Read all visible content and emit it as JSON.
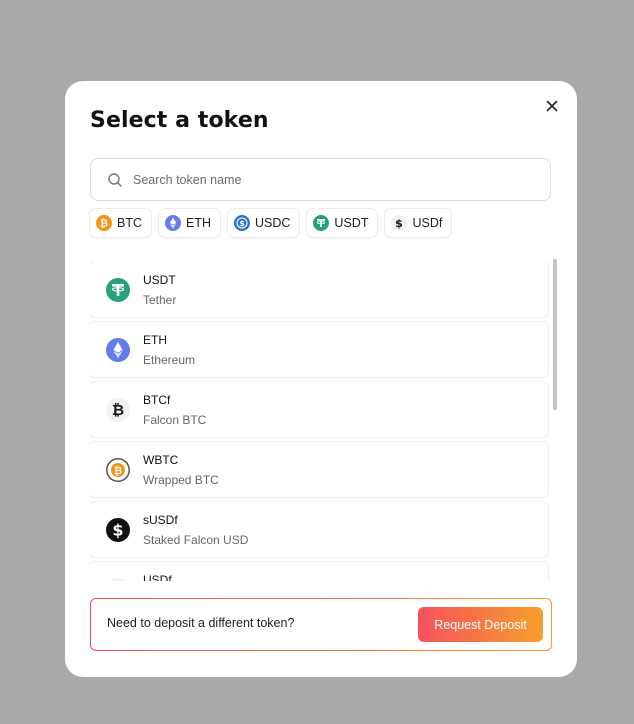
{
  "modal": {
    "title": "Select a token",
    "close_label": "×"
  },
  "search": {
    "placeholder": "Search token name",
    "value": ""
  },
  "quick_tokens": [
    {
      "symbol": "BTC",
      "icon": "btc-icon",
      "color": "#f7931a"
    },
    {
      "symbol": "ETH",
      "icon": "eth-icon",
      "color": "#627eea"
    },
    {
      "symbol": "USDC",
      "icon": "usdc-icon",
      "color": "#2775ca"
    },
    {
      "symbol": "USDT",
      "icon": "usdt-icon",
      "color": "#26a17b"
    },
    {
      "symbol": "USDf",
      "icon": "usdf-icon",
      "color": "#1a1a1a"
    }
  ],
  "tokens": [
    {
      "symbol": "USDT",
      "name": "Tether",
      "icon": "usdt-icon",
      "color": "#26a17b"
    },
    {
      "symbol": "ETH",
      "name": "Ethereum",
      "icon": "eth-icon",
      "color": "#627eea"
    },
    {
      "symbol": "BTCf",
      "name": "Falcon BTC",
      "icon": "btcf-icon",
      "color": "#1a1a1a"
    },
    {
      "symbol": "WBTC",
      "name": "Wrapped BTC",
      "icon": "wbtc-icon",
      "color": "#f7931a"
    },
    {
      "symbol": "sUSDf",
      "name": "Staked Falcon USD",
      "icon": "susdf-icon",
      "color": "#111111"
    },
    {
      "symbol": "USDf",
      "name": "",
      "icon": "usdf-icon",
      "color": "#1a1a1a"
    }
  ],
  "deposit": {
    "prompt": "Need to deposit a different token?",
    "button_label": "Request Deposit",
    "gradient_start": "#f5515f",
    "gradient_end": "#f8a02a"
  }
}
